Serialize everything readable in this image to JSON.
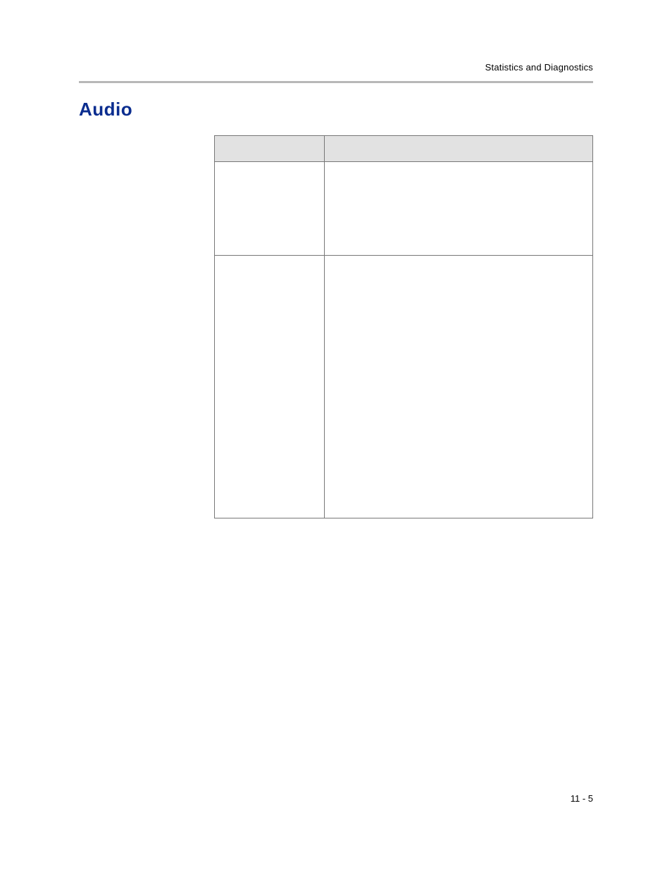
{
  "header": {
    "running_head": "Statistics and Diagnostics"
  },
  "section": {
    "title": "Audio",
    "title_color": "#0b2d8f"
  },
  "table": {
    "columns": [
      "",
      ""
    ],
    "rows": [
      {
        "field": "",
        "description": ""
      },
      {
        "field": "",
        "description": ""
      }
    ]
  },
  "footer": {
    "page_number": "11 - 5"
  }
}
